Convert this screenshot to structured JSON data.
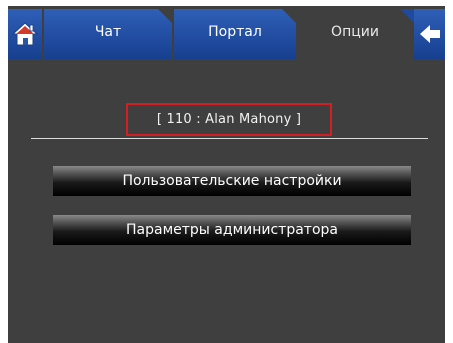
{
  "tabs": [
    {
      "label": "Чат",
      "active": false
    },
    {
      "label": "Портал",
      "active": false
    },
    {
      "label": "Опции",
      "active": true
    }
  ],
  "user_box": {
    "text": "[ 110 : Alan Mahony ]"
  },
  "buttons": {
    "user_settings": "Пользовательские настройки",
    "admin_params": "Параметры администратора"
  },
  "colors": {
    "tab_blue": "#2f5fb8",
    "background": "#3f3f3f",
    "highlight_border": "#d21f24"
  },
  "icons": {
    "home": "home-icon",
    "back": "back-arrow-icon"
  }
}
